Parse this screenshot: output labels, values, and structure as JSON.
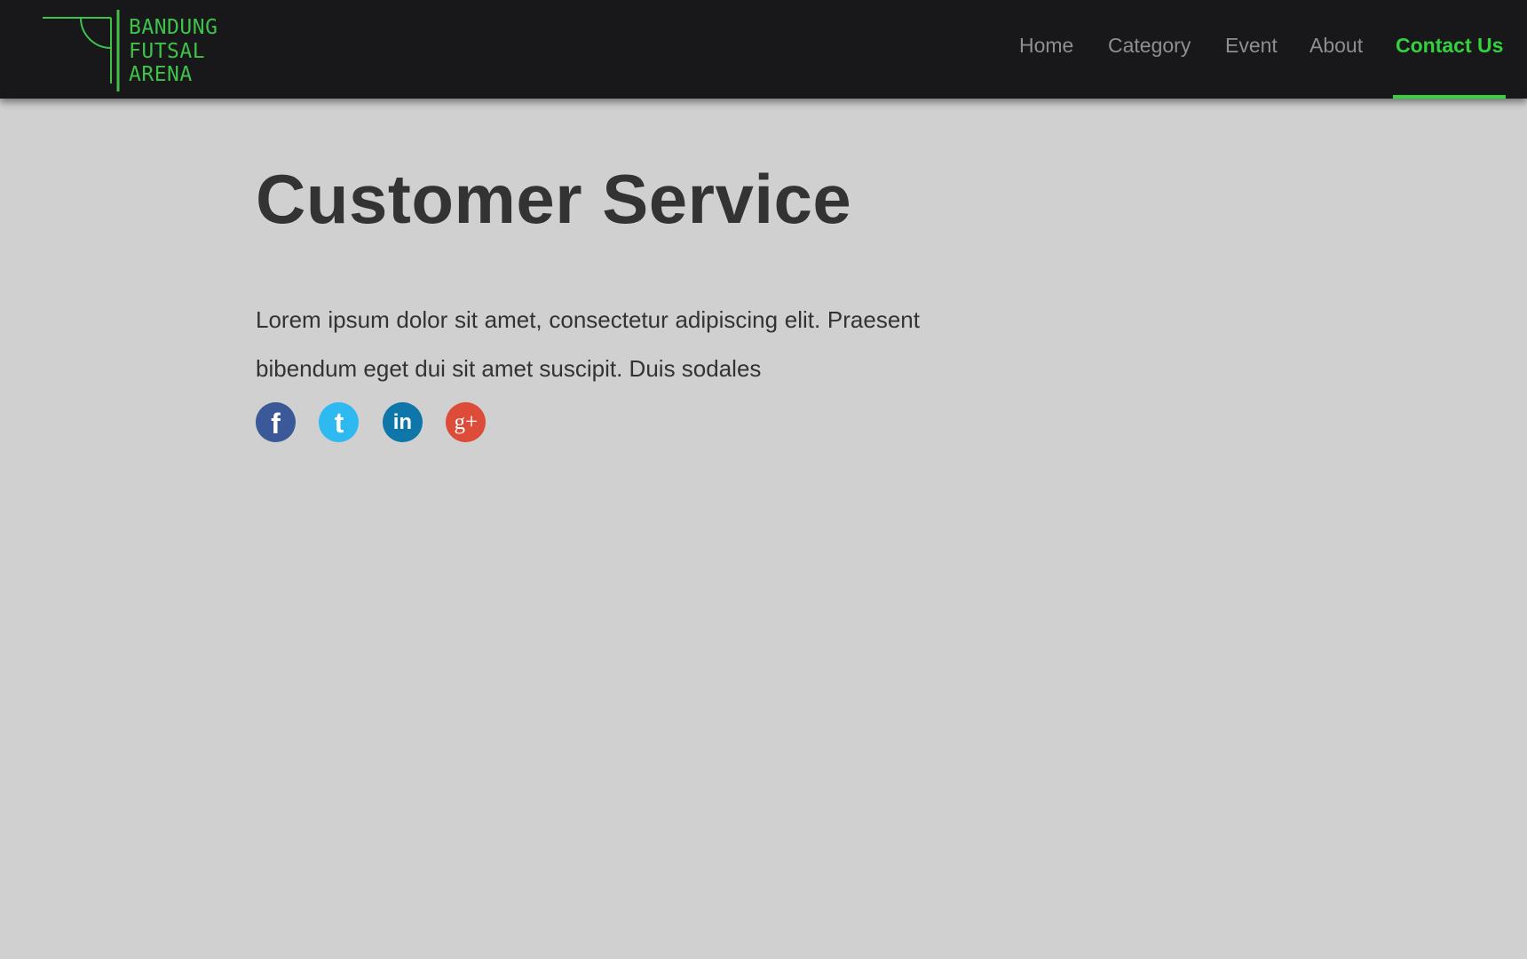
{
  "brand": {
    "logo_lines": [
      "BANDUNG",
      "FUTSAL",
      "ARENA"
    ],
    "color": "#3fc24a"
  },
  "nav": {
    "items": [
      {
        "label": "Home",
        "active": false
      },
      {
        "label": "Category",
        "active": false
      },
      {
        "label": "Event",
        "active": false
      },
      {
        "label": "About",
        "active": false
      },
      {
        "label": "Contact Us",
        "active": true
      }
    ],
    "active_color": "#33d13e",
    "inactive_color": "#8f8f8f"
  },
  "main": {
    "title": "Customer Service",
    "intro": "Lorem ipsum dolor sit amet, consectetur adipiscing elit. Praesent bibendum eget dui sit amet suscipit. Duis sodales"
  },
  "socials": [
    {
      "icon": "facebook-icon",
      "glyph": "f",
      "color": "#3b5998"
    },
    {
      "icon": "twitter-icon",
      "glyph": "t",
      "color": "#2ebaf0"
    },
    {
      "icon": "linkedin-icon",
      "glyph": "in",
      "color": "#0e76a8"
    },
    {
      "icon": "google-plus-icon",
      "glyph": "g+",
      "color": "#dd4b39"
    }
  ],
  "colors": {
    "header_bg": "#18181b",
    "page_bg": "#d0d0d0",
    "text": "#333333"
  }
}
